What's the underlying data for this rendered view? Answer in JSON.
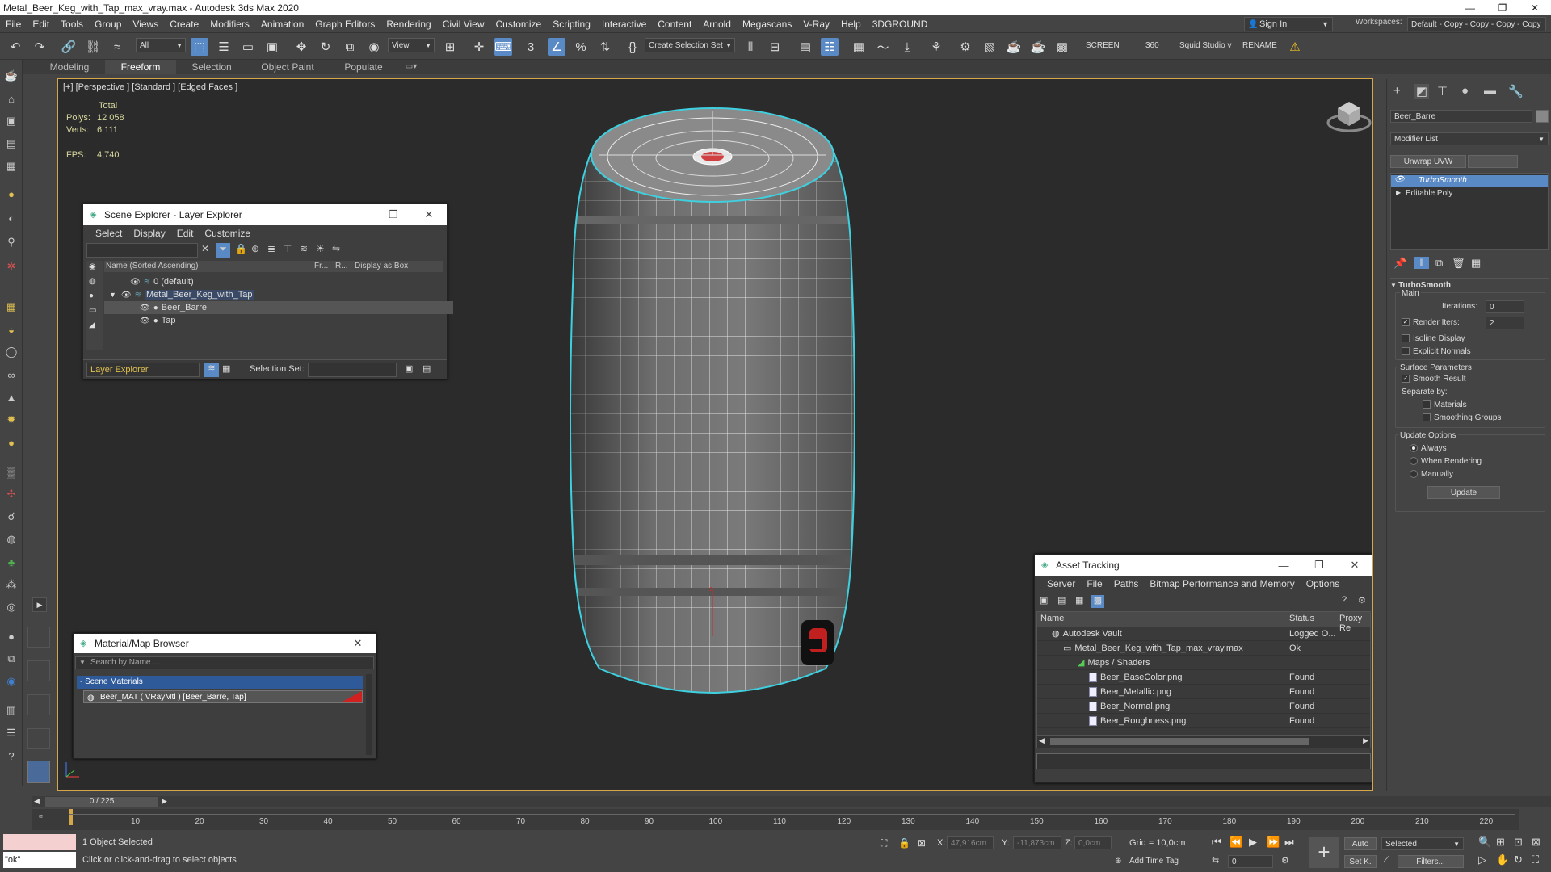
{
  "window": {
    "title": "Metal_Beer_Keg_with_Tap_max_vray.max - Autodesk 3ds Max 2020",
    "minimize": "—",
    "maximize": "❐",
    "close": "✕"
  },
  "menubar": {
    "items": [
      "File",
      "Edit",
      "Tools",
      "Group",
      "Views",
      "Create",
      "Modifiers",
      "Animation",
      "Graph Editors",
      "Rendering",
      "Civil View",
      "Customize",
      "Scripting",
      "Interactive",
      "Content",
      "Arnold",
      "Megascans",
      "V-Ray",
      "Help",
      "3DGROUND"
    ],
    "sign_in": "Sign In",
    "workspaces_label": "Workspaces:",
    "workspace_value": "Default - Copy - Copy - Copy - Copy"
  },
  "toolbar": {
    "filter_value": "All",
    "view_value": "View",
    "selection_set": "Create Selection Set",
    "screen_label": "SCREEN",
    "deg_label": "360",
    "squid_label": "Squid Studio v",
    "rename_label": "RENAME"
  },
  "ribbon": {
    "tabs": [
      "Modeling",
      "Freeform",
      "Selection",
      "Object Paint",
      "Populate"
    ]
  },
  "viewport": {
    "label": "[+] [Perspective ] [Standard ] [Edged Faces ]",
    "stats": {
      "total_label": "Total",
      "polys_label": "Polys:",
      "polys": "12 058",
      "verts_label": "Verts:",
      "verts": "6 111",
      "fps_label": "FPS:",
      "fps": "4,740"
    },
    "axis_z": "z"
  },
  "scene_explorer": {
    "title": "Scene Explorer - Layer Explorer",
    "menu": [
      "Select",
      "Display",
      "Edit",
      "Customize"
    ],
    "columns": {
      "name": "Name (Sorted Ascending)",
      "fr": "Fr...",
      "r": "R...",
      "display": "Display as Box"
    },
    "rows": [
      {
        "name": "0 (default)",
        "indent": 0
      },
      {
        "name": "Metal_Beer_Keg_with_Tap",
        "indent": 0
      },
      {
        "name": "Beer_Barre",
        "indent": 1
      },
      {
        "name": "Tap",
        "indent": 1
      }
    ],
    "footer_layer": "Layer Explorer",
    "footer_sel_label": "Selection Set:"
  },
  "material_browser": {
    "title": "Material/Map Browser",
    "search_placeholder": "Search by Name ...",
    "section": "- Scene Materials",
    "item": "Beer_MAT  ( VRayMtl )  [Beer_Barre, Tap]"
  },
  "asset_tracking": {
    "title": "Asset Tracking",
    "menu": [
      "Server",
      "File",
      "Paths",
      "Bitmap Performance and Memory",
      "Options"
    ],
    "columns": {
      "name": "Name",
      "status": "Status",
      "proxy": "Proxy Re"
    },
    "rows": [
      {
        "name": "Autodesk Vault",
        "status": "Logged O..."
      },
      {
        "name": "Metal_Beer_Keg_with_Tap_max_vray.max",
        "status": "Ok"
      },
      {
        "name": "Maps / Shaders",
        "status": ""
      },
      {
        "name": "Beer_BaseColor.png",
        "status": "Found"
      },
      {
        "name": "Beer_Metallic.png",
        "status": "Found"
      },
      {
        "name": "Beer_Normal.png",
        "status": "Found"
      },
      {
        "name": "Beer_Roughness.png",
        "status": "Found"
      }
    ]
  },
  "command_panel": {
    "object_name": "Beer_Barre",
    "modifier_list": "Modifier List",
    "unwrap_btn": "Unwrap UVW",
    "stack": [
      "TurboSmooth",
      "Editable Poly"
    ],
    "turbosmooth": {
      "header": "TurboSmooth",
      "main": "Main",
      "iterations_label": "Iterations:",
      "iterations": "0",
      "render_iters_label": "Render Iters:",
      "render_iters": "2",
      "isoline": "Isoline Display",
      "explicit": "Explicit Normals",
      "surface": "Surface Parameters",
      "smooth_result": "Smooth Result",
      "separate": "Separate by:",
      "materials": "Materials",
      "smoothing": "Smoothing Groups",
      "update_options": "Update Options",
      "always": "Always",
      "when_rendering": "When Rendering",
      "manually": "Manually",
      "update_btn": "Update"
    },
    "accent": "#5a8ac6"
  },
  "timeline": {
    "frame": "0 / 225",
    "ticks": [
      "10",
      "20",
      "30",
      "40",
      "50",
      "60",
      "70",
      "80",
      "90",
      "100",
      "110",
      "120",
      "130",
      "140",
      "150",
      "160",
      "170",
      "180",
      "190",
      "200",
      "210",
      "220"
    ]
  },
  "status": {
    "maxscript_value": "\"ok\"",
    "selected": "1 Object Selected",
    "prompt": "Click or click-and-drag to select objects",
    "x_label": "X:",
    "x_val": "47,916cm",
    "y_label": "Y:",
    "y_val": "-11,873cm",
    "z_label": "Z:",
    "z_val": "0,0cm",
    "grid": "Grid = 10,0cm",
    "add_time_tag": "Add Time Tag",
    "auto": "Auto",
    "set_k": "Set K.",
    "selected_dropdown": "Selected",
    "filters": "Filters...",
    "frame_value": "0"
  }
}
